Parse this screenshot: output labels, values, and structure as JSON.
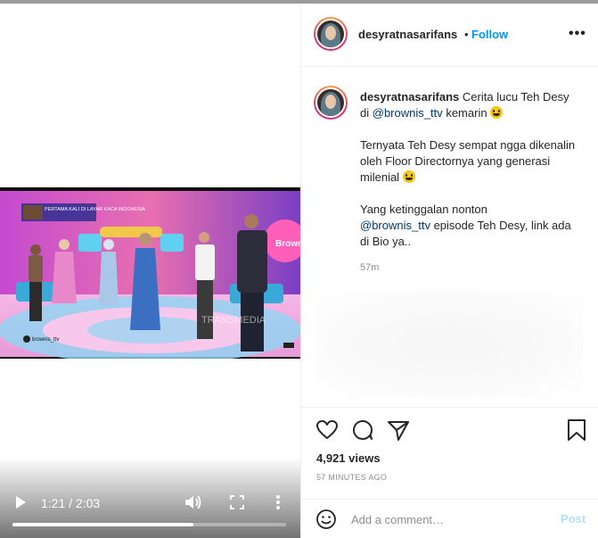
{
  "video": {
    "time_current": "1:21",
    "time_total": "2:03",
    "time_readout": "1:21 / 2:03",
    "progress_fraction": 0.66,
    "overlay_banner": "PERTAMA KALI DI LAYAR KACA INDONESIA",
    "watermark": "brownis_ttv",
    "show_logo_text": "Brownis",
    "broadcaster_text": "TRANSMEDIA",
    "play_icon": "play-icon",
    "volume_icon": "volume-icon",
    "fullscreen_icon": "fullscreen-icon",
    "more_icon": "more-vertical-icon"
  },
  "header": {
    "username": "desyratnasarifans",
    "separator": "•",
    "follow_label": "Follow",
    "options_label": "•••"
  },
  "caption": {
    "username": "desyratnasarifans",
    "line1_text": "Cerita lucu Teh Desy di",
    "line1_mention": "@brownis_ttv",
    "line1_tail": "kemarin",
    "paragraph2": "Ternyata Teh Desy sempat ngga dikenalin oleh Floor Directornya yang generasi milenial",
    "paragraph3_text": "Yang ketinggalan nonton",
    "paragraph3_mention": "@brownis_ttv",
    "paragraph3_tail": "episode Teh Desy, link ada di Bio ya..",
    "age": "57m"
  },
  "actions": {
    "views": "4,921 views",
    "timestamp": "57 MINUTES AGO"
  },
  "comment": {
    "placeholder": "Add a comment…",
    "post_label": "Post"
  },
  "colors": {
    "link_blue": "#0095f6",
    "mention_blue": "#00376b",
    "post_disabled": "#b2dffc",
    "muted_text": "#8e8e8e"
  }
}
